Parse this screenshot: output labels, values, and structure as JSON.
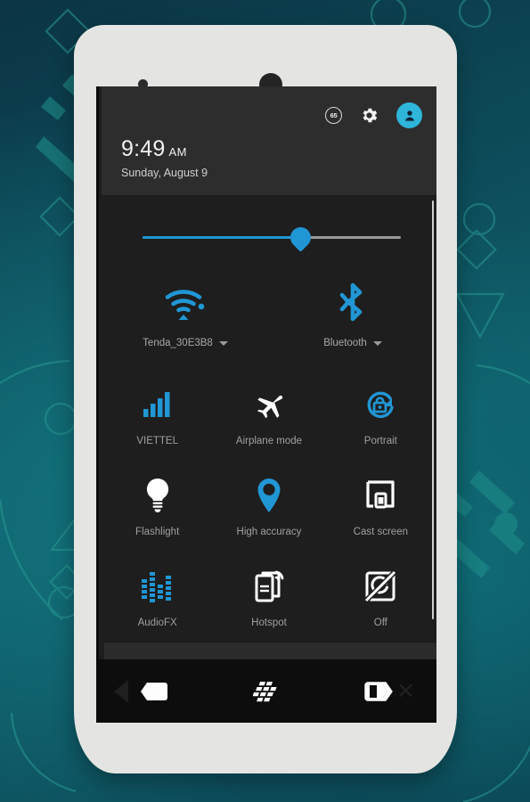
{
  "background": {
    "style": "dark-teal-gradient-with-geometric-shapes",
    "base_color": "#0d4a58",
    "shape_color": "#1f8b87"
  },
  "device": {
    "name": "white-android-phone",
    "body_color": "#e4e4e2",
    "sensor_icon": "proximity-sensor",
    "speaker_icon": "earpiece-speaker"
  },
  "statusbar": {
    "battery_level": "65",
    "battery_icon": "battery-circle-icon",
    "settings_icon": "gear-icon",
    "user_icon": "user-avatar-icon",
    "accent": "#2eb5d9"
  },
  "clock": {
    "time": "9:49",
    "ampm": "AM",
    "date": "Sunday, August 9"
  },
  "brightness": {
    "label": "brightness-slider",
    "value_percent": 61,
    "fill_color": "#2196d4",
    "track_color": "#9a9a9a"
  },
  "connectivity": [
    {
      "id": "wifi",
      "icon": "wifi-icon",
      "label": "Tenda_30E3B8",
      "has_caret": true,
      "color": "#2196d4"
    },
    {
      "id": "bluetooth",
      "icon": "bluetooth-icon",
      "label": "Bluetooth",
      "has_caret": true,
      "color": "#2196d4"
    }
  ],
  "tiles": [
    [
      {
        "id": "mobile-data",
        "icon": "signal-bars-icon",
        "label": "VIETTEL",
        "color": "#2196d4"
      },
      {
        "id": "airplane-mode",
        "icon": "airplane-icon",
        "label": "Airplane mode",
        "color": "#ffffff"
      },
      {
        "id": "rotation",
        "icon": "rotation-lock-icon",
        "label": "Portrait",
        "color": "#2196d4"
      }
    ],
    [
      {
        "id": "flashlight",
        "icon": "lightbulb-icon",
        "label": "Flashlight",
        "color": "#ffffff"
      },
      {
        "id": "location",
        "icon": "location-pin-icon",
        "label": "High accuracy",
        "color": "#2196d4"
      },
      {
        "id": "cast",
        "icon": "cast-screen-icon",
        "label": "Cast screen",
        "color": "#ffffff"
      }
    ],
    [
      {
        "id": "audiofx",
        "icon": "equalizer-icon",
        "label": "AudioFX",
        "color": "#2196d4"
      },
      {
        "id": "hotspot",
        "icon": "hotspot-icon",
        "label": "Hotspot",
        "color": "#ffffff"
      },
      {
        "id": "sync",
        "icon": "sync-off-icon",
        "label": "Off",
        "color": "#ffffff"
      }
    ]
  ],
  "panel": {
    "drag_handle": "quick-settings-drag-handle",
    "scrollbar": "panel-scrollbar"
  },
  "navbar": [
    {
      "id": "back",
      "icon": "blackberry-back-icon"
    },
    {
      "id": "home",
      "icon": "blackberry-logo-icon"
    },
    {
      "id": "recents",
      "icon": "blackberry-recents-icon"
    }
  ]
}
